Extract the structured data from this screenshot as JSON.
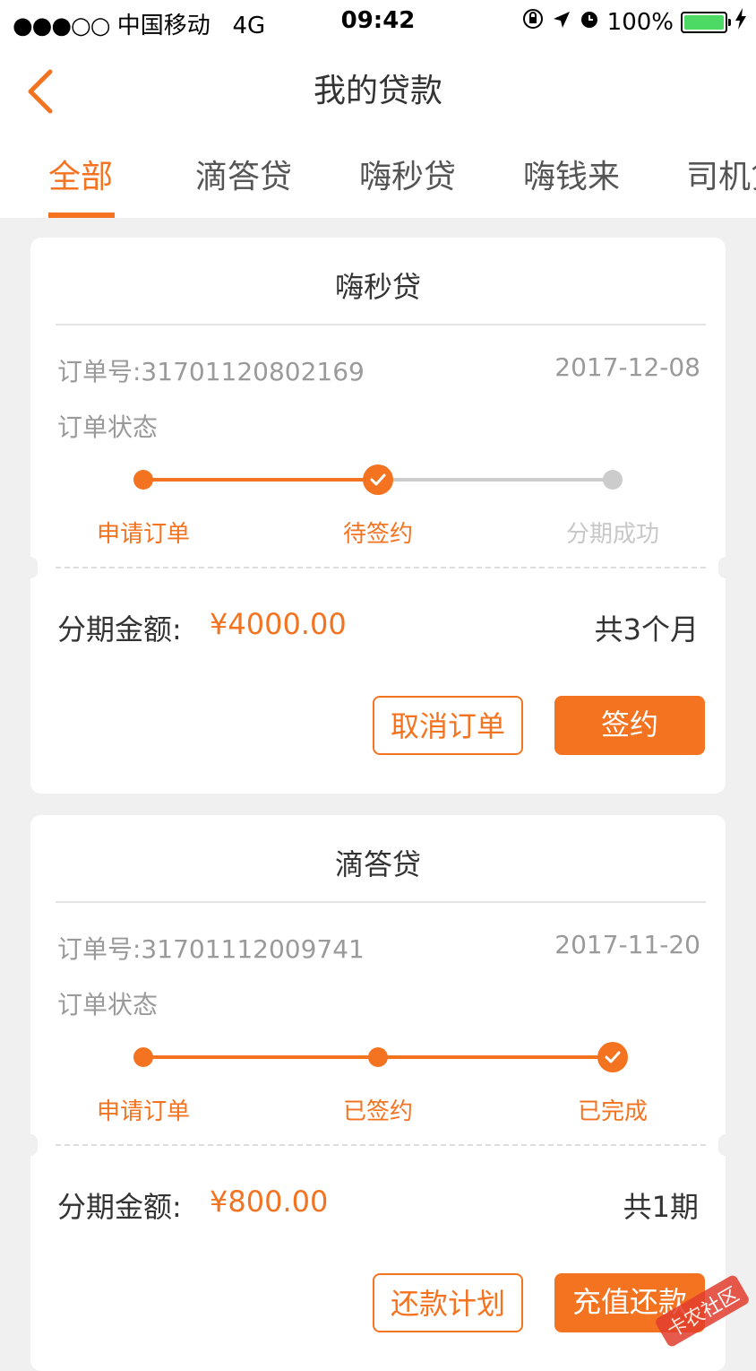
{
  "status_bar": {
    "carrier": "中国移动",
    "network": "4G",
    "time": "09:42",
    "battery": "100%"
  },
  "header": {
    "title": "我的贷款"
  },
  "tabs": [
    "全部",
    "滴答贷",
    "嗨秒贷",
    "嗨钱来",
    "司机贷"
  ],
  "colors": {
    "accent": "#f47320",
    "inactive_step": "#cccccc"
  },
  "cards": [
    {
      "title": "嗨秒贷",
      "order_no": "订单号:31701120802169",
      "date": "2017-12-08",
      "status_label": "订单状态",
      "steps": [
        "申请订单",
        "待签约",
        "分期成功"
      ],
      "current_step": 2,
      "amount_label": "分期金额:",
      "amount": "¥4000.00",
      "term": "共3个月",
      "btn_secondary": "取消订单",
      "btn_primary": "签约"
    },
    {
      "title": "滴答贷",
      "order_no": "订单号:31701112009741",
      "date": "2017-11-20",
      "status_label": "订单状态",
      "steps": [
        "申请订单",
        "已签约",
        "已完成"
      ],
      "current_step": 3,
      "amount_label": "分期金额:",
      "amount": "¥800.00",
      "term": "共1期",
      "btn_secondary": "还款计划",
      "btn_primary": "充值还款"
    }
  ],
  "watermark": "卡农社区"
}
